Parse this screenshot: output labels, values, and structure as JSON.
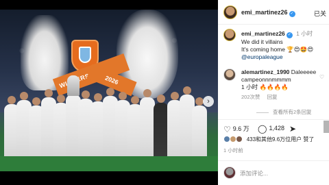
{
  "photo": {
    "banner_text": "WINNERS",
    "banner_year": "2026"
  },
  "post": {
    "author": "emi_martinez26",
    "follow_label": "已关",
    "caption": {
      "username": "emi_martinez26",
      "time": "1 小时",
      "line1": "We did it villains",
      "line2": "It's coming home 🏆😍🤩😍",
      "link": "@europaleague"
    },
    "comment": {
      "username": "alemartinez_1990",
      "text": "Daleeeee campeonnnmmmm",
      "time_and_emoji": "1 小时 🔥🔥🔥🔥",
      "likes": "202次赞",
      "reply": "回复",
      "view_replies": "查看所有2条回复"
    },
    "actions": {
      "likes_count": "9.6 万",
      "comments_count": "1,428"
    },
    "liked_by": "433和其他9.6万位用户 赞了",
    "time_ago": "1 小时前",
    "add_comment_placeholder": "添加评论..."
  },
  "icons": {
    "like": "heart-icon",
    "comment": "comment-icon",
    "share": "share-icon",
    "next": "chevron-right-icon"
  },
  "colors": {
    "verified": "#3897f0",
    "link": "#00376b",
    "banner": "#e2772a"
  }
}
